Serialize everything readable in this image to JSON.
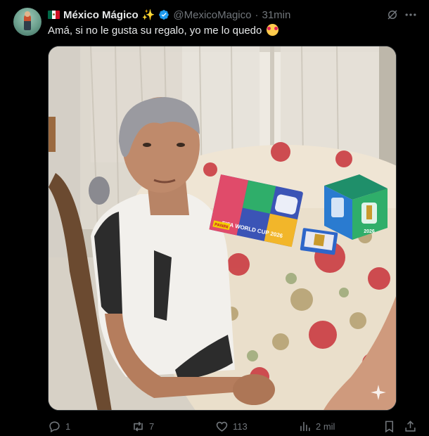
{
  "post": {
    "display_name": "México Mágico",
    "handle": "@MexicoMagico",
    "separator": "·",
    "time": "31min",
    "text": "Amá, si no le gusta su regalo, yo me lo quedo",
    "emoji": "smiling-face-with-hearts"
  },
  "media": {
    "album_text": "FIFA WORLD CUP 2026",
    "album_brand": "PANINI",
    "box_text": "2026"
  },
  "actions": {
    "reply_count": "1",
    "repost_count": "7",
    "like_count": "113",
    "views_count": "2 mil"
  },
  "colors": {
    "background": "#000000",
    "text_primary": "#e7e9ea",
    "text_secondary": "#71767b",
    "verified": "#1d9bf0"
  },
  "icons": {
    "verified": "verified-badge-icon",
    "grok": "grok-icon",
    "more": "more-horizontal-icon",
    "reply": "reply-icon",
    "repost": "repost-icon",
    "like": "heart-icon",
    "views": "views-bar-chart-icon",
    "bookmark": "bookmark-icon",
    "share": "share-icon"
  }
}
